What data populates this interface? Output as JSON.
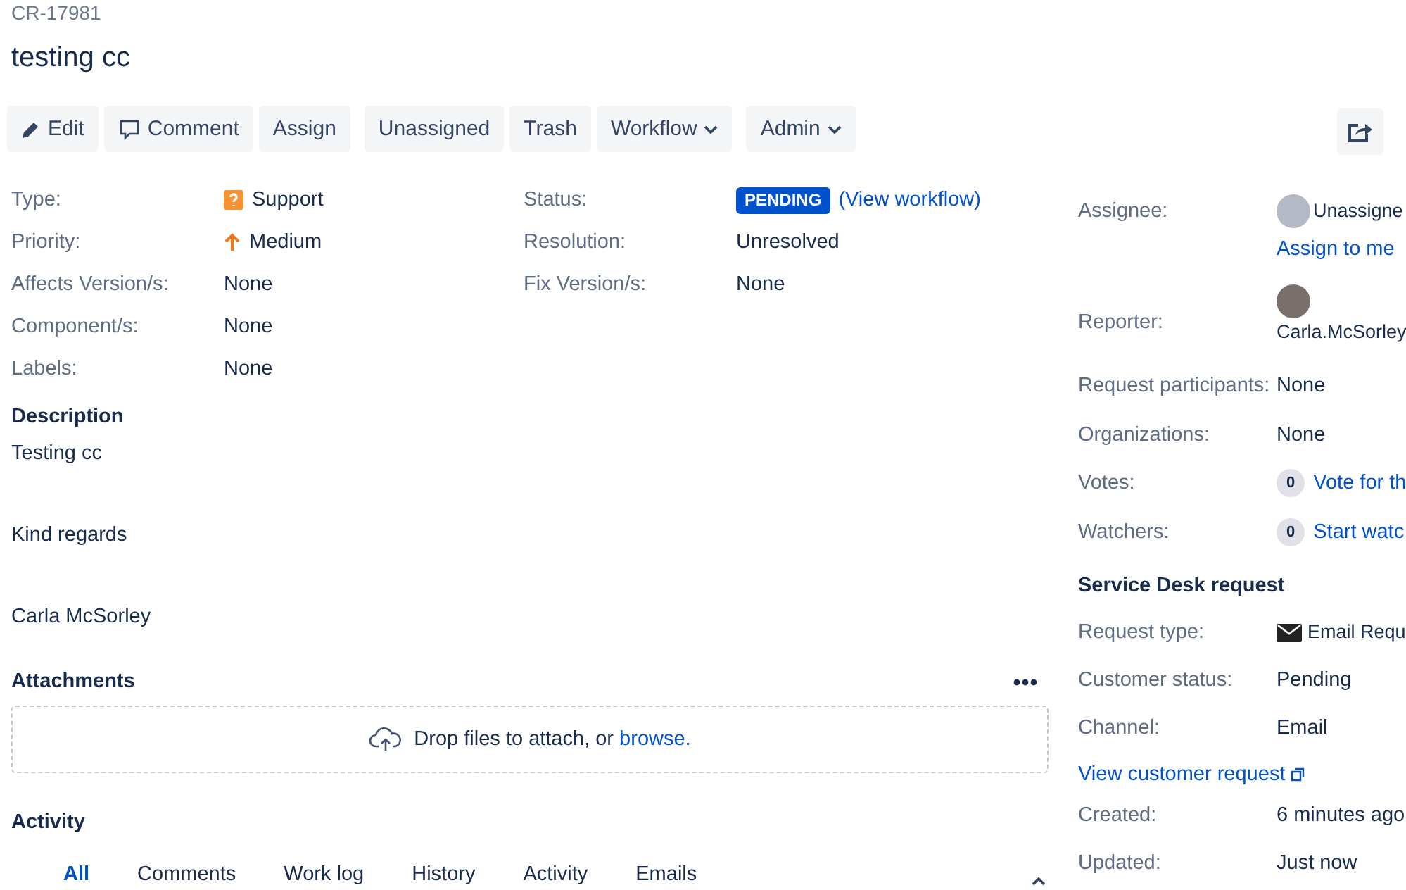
{
  "issue_key": "CR-17981",
  "title": "testing cc",
  "toolbar": {
    "groups": [
      [
        {
          "label": "Edit",
          "kind": "pencil",
          "dropdown": false
        },
        {
          "label": "Comment",
          "kind": "comment",
          "dropdown": false
        },
        {
          "label": "Assign",
          "kind": "plain",
          "dropdown": false
        }
      ],
      [
        {
          "label": "Unassigned",
          "kind": "plain",
          "dropdown": false
        },
        {
          "label": "Trash",
          "kind": "plain",
          "dropdown": false
        },
        {
          "label": "Workflow",
          "kind": "plain",
          "dropdown": true
        }
      ],
      [
        {
          "label": "Admin",
          "kind": "plain",
          "dropdown": true
        }
      ]
    ]
  },
  "details": {
    "left": [
      {
        "label": "Type:",
        "value": "Support",
        "kind": "issue_type"
      },
      {
        "label": "Priority:",
        "value": "Medium",
        "kind": "priority"
      },
      {
        "label": "Affects Version/s:",
        "value": "None",
        "kind": "text"
      },
      {
        "label": "Component/s:",
        "value": "None",
        "kind": "text"
      },
      {
        "label": "Labels:",
        "value": "None",
        "kind": "text"
      }
    ],
    "right": [
      {
        "label": "Status:",
        "value": "PENDING",
        "link": "(View workflow)",
        "kind": "status"
      },
      {
        "label": "Resolution:",
        "value": "Unresolved",
        "kind": "text"
      },
      {
        "label": "Fix Version/s:",
        "value": "None",
        "kind": "text"
      }
    ]
  },
  "description": {
    "heading": "Description",
    "paragraphs": [
      "Testing cc",
      "Kind regards",
      "Carla McSorley"
    ]
  },
  "attachments": {
    "heading": "Attachments",
    "drop_text": "Drop files to attach, or",
    "browse_link": "browse."
  },
  "activity": {
    "heading": "Activity",
    "tabs": [
      {
        "label": "All",
        "selected": true
      },
      {
        "label": "Comments",
        "selected": false
      },
      {
        "label": "Work log",
        "selected": false
      },
      {
        "label": "History",
        "selected": false
      },
      {
        "label": "Activity",
        "selected": false
      },
      {
        "label": "Emails",
        "selected": false
      }
    ]
  },
  "people": [
    {
      "label": "Assignee:",
      "kind": "user_unknown",
      "value": "Unassigne",
      "link": "Assign to me"
    },
    {
      "label": "Reporter:",
      "kind": "user_photo",
      "value": "Carla.McSorley"
    },
    {
      "label": "Request participants:",
      "kind": "text",
      "value": "None"
    },
    {
      "label": "Organizations:",
      "kind": "text",
      "value": "None"
    },
    {
      "label": "Votes:",
      "kind": "counter",
      "count": "0",
      "link": "Vote for th"
    },
    {
      "label": "Watchers:",
      "kind": "counter",
      "count": "0",
      "link": "Start watc"
    }
  ],
  "service_desk": {
    "heading": "Service Desk request",
    "fields": [
      {
        "label": "Request type:",
        "kind": "email",
        "value": "Email Requ"
      },
      {
        "label": "Customer status:",
        "kind": "text",
        "value": "Pending"
      },
      {
        "label": "Channel:",
        "kind": "text",
        "value": "Email"
      },
      {
        "label": "View customer request",
        "kind": "link"
      },
      {
        "label": "Created:",
        "kind": "text",
        "value": "6 minutes ago"
      },
      {
        "label": "Updated:",
        "kind": "text",
        "value": "Just now"
      }
    ]
  }
}
